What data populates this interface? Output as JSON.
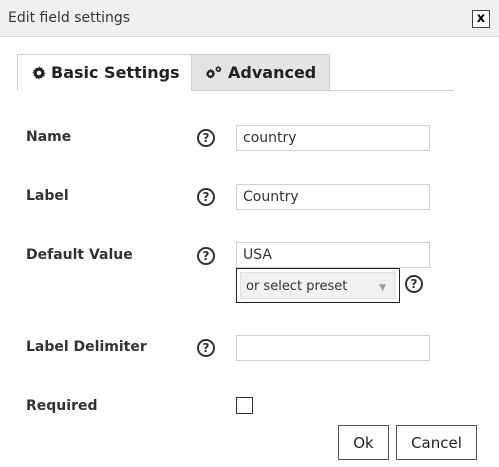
{
  "dialog": {
    "title": "Edit field settings",
    "close_label": "x"
  },
  "tabs": [
    {
      "label": "Basic Settings",
      "icon": "gear-icon",
      "active": true
    },
    {
      "label": "Advanced",
      "icon": "gears-icon",
      "active": false
    }
  ],
  "fields": {
    "name": {
      "label": "Name",
      "value": "country"
    },
    "label": {
      "label": "Label",
      "value": "Country"
    },
    "default_value": {
      "label": "Default Value",
      "value": "USA",
      "preset_selected": "or select preset"
    },
    "label_delimiter": {
      "label": "Label Delimiter",
      "value": ""
    },
    "required": {
      "label": "Required",
      "checked": false
    }
  },
  "help_glyph": "?",
  "buttons": {
    "ok": "Ok",
    "cancel": "Cancel"
  },
  "colors": {
    "titlebar_bg": "#f0f0f0",
    "inactive_tab_bg": "#e4e4e4",
    "border": "#cfcfcf"
  }
}
